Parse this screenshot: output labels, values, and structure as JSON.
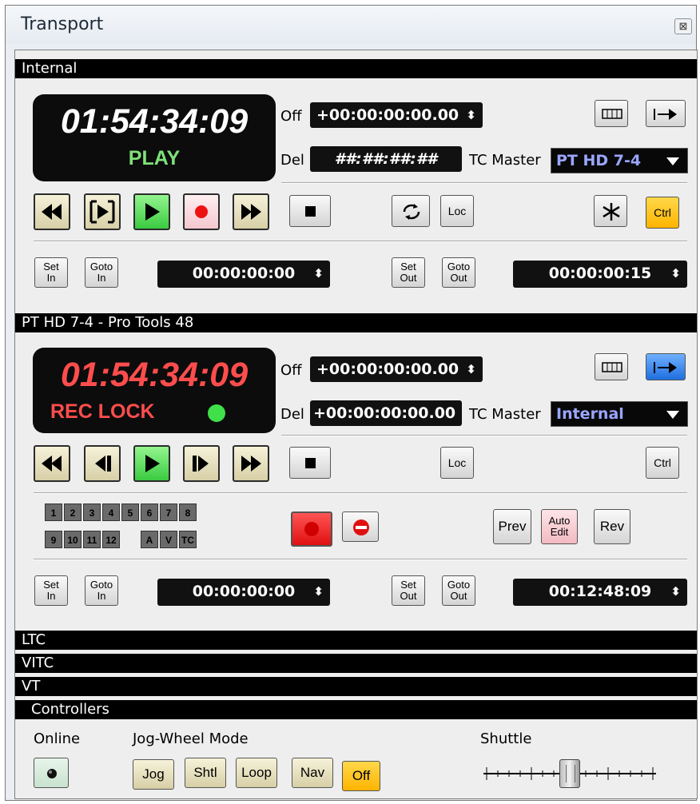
{
  "window": {
    "title": "Transport",
    "close_glyph": "⊠"
  },
  "internal": {
    "header": "Internal",
    "timecode": "01:54:34:09",
    "status": "PLAY",
    "off_label": "Off",
    "off_value": "+00:00:00:00.00",
    "del_label": "Del",
    "del_value": "##:##:##:##",
    "tc_master_label": "TC Master",
    "tc_master_value": "PT HD 7-4",
    "loc_label": "Loc",
    "ctrl_label": "Ctrl",
    "set_in": [
      "Set",
      "In"
    ],
    "goto_in": [
      "Goto",
      "In"
    ],
    "in_value": "00:00:00:00",
    "set_out": [
      "Set",
      "Out"
    ],
    "goto_out": [
      "Goto",
      "Out"
    ],
    "out_value": "00:00:00:15"
  },
  "device": {
    "header": "PT HD 7-4 - Pro Tools 48",
    "timecode": "01:54:34:09",
    "status": "REC LOCK",
    "off_label": "Off",
    "off_value": "+00:00:00:00.00",
    "del_label": "Del",
    "del_value": "+00:00:00:00.00",
    "tc_master_label": "TC Master",
    "tc_master_value": "Internal",
    "loc_label": "Loc",
    "ctrl_label": "Ctrl",
    "tracks_row1": [
      "1",
      "2",
      "3",
      "4",
      "5",
      "6",
      "7",
      "8"
    ],
    "tracks_row2": [
      "9",
      "10",
      "11",
      "12"
    ],
    "tracks_avtc": [
      "A",
      "V",
      "TC"
    ],
    "prev_label": "Prev",
    "auto_edit": [
      "Auto",
      "Edit"
    ],
    "rev_label": "Rev",
    "set_in": [
      "Set",
      "In"
    ],
    "goto_in": [
      "Goto",
      "In"
    ],
    "in_value": "00:00:00:00",
    "set_out": [
      "Set",
      "Out"
    ],
    "goto_out": [
      "Goto",
      "Out"
    ],
    "out_value": "00:12:48:09"
  },
  "sections": {
    "ltc": "LTC",
    "vitc": "VITC",
    "vt": "VT",
    "controllers": "Controllers"
  },
  "controllers": {
    "online_label": "Online",
    "jog_mode_label": "Jog-Wheel Mode",
    "jog": "Jog",
    "shtl": "Shtl",
    "loop": "Loop",
    "nav": "Nav",
    "off": "Off",
    "shuttle_label": "Shuttle"
  },
  "colors": {
    "play_green": "#7fe07a",
    "rec_red": "#ff4d4d",
    "accent_yellow": "#ffc000",
    "accent_blue": "#2f7ff0",
    "dropdown_text": "#9aa6ff"
  }
}
